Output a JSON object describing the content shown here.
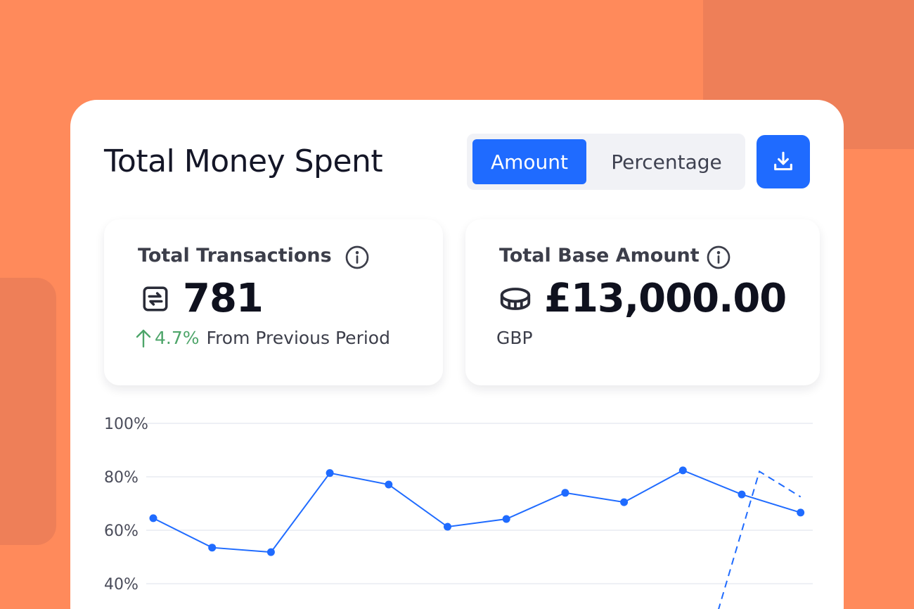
{
  "header": {
    "title": "Total Money Spent",
    "toggle": {
      "amount_label": "Amount",
      "percentage_label": "Percentage",
      "selected": "Amount"
    },
    "download_icon": "download-icon"
  },
  "stats": [
    {
      "label": "Total Transactions",
      "info_icon": "info-icon",
      "icon": "exchange-icon",
      "value": "781",
      "trend_value": "4.7%",
      "trend_direction": "up",
      "trend_text": "From Previous Period"
    },
    {
      "label": "Total Base Amount",
      "info_icon": "info-icon",
      "icon": "coins-icon",
      "value": "£13,000.00",
      "currency": "GBP"
    }
  ],
  "colors": {
    "accent": "#1F6BFF",
    "background": "#FF8A5B",
    "trend_up": "#4EA56A"
  },
  "chart_data": {
    "type": "line",
    "y_ticks": [
      "100%",
      "80%",
      "60%",
      "40%"
    ],
    "ylim": [
      40,
      100
    ],
    "grid": true,
    "series": [
      {
        "values": [
          64.5,
          53.5,
          51.8,
          81.4,
          77.1,
          61.3,
          64.2,
          74.0,
          70.5,
          82.4,
          73.4,
          66.6
        ],
        "style": "solid",
        "markers": true
      },
      {
        "points": [
          {
            "x": 10.6,
            "y": 30
          },
          {
            "x": 11.3,
            "y": 82
          },
          {
            "x": 12,
            "y": 72.5
          }
        ],
        "style": "dashed",
        "markers": false
      }
    ]
  }
}
